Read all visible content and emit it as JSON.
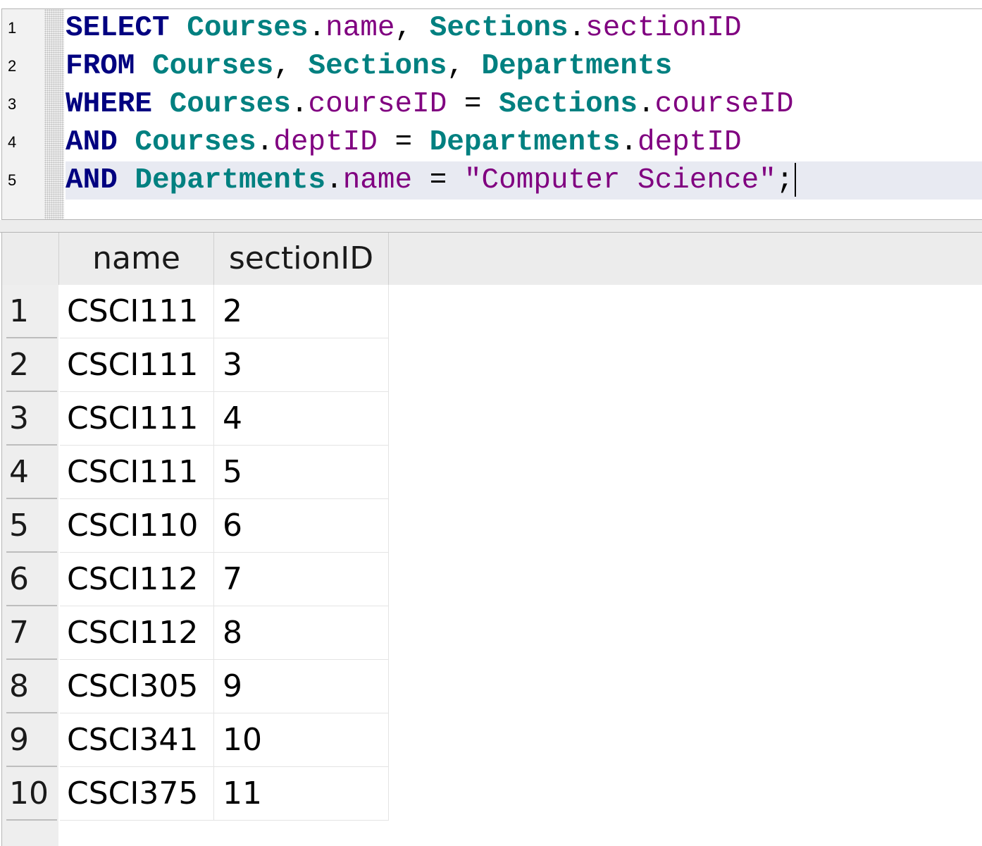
{
  "editor": {
    "line_numbers": [
      "1",
      "2",
      "3",
      "4",
      "5"
    ],
    "lines": [
      [
        {
          "t": "SELECT",
          "c": "kw"
        },
        {
          "t": " ",
          "c": "op"
        },
        {
          "t": "Courses",
          "c": "tbl"
        },
        {
          "t": ".",
          "c": "op"
        },
        {
          "t": "name",
          "c": "col"
        },
        {
          "t": ", ",
          "c": "op"
        },
        {
          "t": "Sections",
          "c": "tbl"
        },
        {
          "t": ".",
          "c": "op"
        },
        {
          "t": "sectionID",
          "c": "col"
        }
      ],
      [
        {
          "t": "FROM",
          "c": "kw"
        },
        {
          "t": " ",
          "c": "op"
        },
        {
          "t": "Courses",
          "c": "tbl"
        },
        {
          "t": ", ",
          "c": "op"
        },
        {
          "t": "Sections",
          "c": "tbl"
        },
        {
          "t": ", ",
          "c": "op"
        },
        {
          "t": "Departments",
          "c": "tbl"
        }
      ],
      [
        {
          "t": "WHERE",
          "c": "kw"
        },
        {
          "t": " ",
          "c": "op"
        },
        {
          "t": "Courses",
          "c": "tbl"
        },
        {
          "t": ".",
          "c": "op"
        },
        {
          "t": "courseID",
          "c": "col"
        },
        {
          "t": " = ",
          "c": "op"
        },
        {
          "t": "Sections",
          "c": "tbl"
        },
        {
          "t": ".",
          "c": "op"
        },
        {
          "t": "courseID",
          "c": "col"
        }
      ],
      [
        {
          "t": "AND",
          "c": "kw"
        },
        {
          "t": " ",
          "c": "op"
        },
        {
          "t": "Courses",
          "c": "tbl"
        },
        {
          "t": ".",
          "c": "op"
        },
        {
          "t": "deptID",
          "c": "col"
        },
        {
          "t": " = ",
          "c": "op"
        },
        {
          "t": "Departments",
          "c": "tbl"
        },
        {
          "t": ".",
          "c": "op"
        },
        {
          "t": "deptID",
          "c": "col"
        }
      ],
      [
        {
          "t": "AND",
          "c": "kw"
        },
        {
          "t": " ",
          "c": "op"
        },
        {
          "t": "Departments",
          "c": "tbl"
        },
        {
          "t": ".",
          "c": "op"
        },
        {
          "t": "name",
          "c": "col"
        },
        {
          "t": " = ",
          "c": "op"
        },
        {
          "t": "\"Computer Science\"",
          "c": "str"
        },
        {
          "t": ";",
          "c": "op"
        }
      ]
    ],
    "current_line": 5,
    "colors": {
      "keyword": "#000080",
      "table": "#008080",
      "column": "#800080",
      "string": "#800080",
      "current_line_bg": "#e8eaf2"
    }
  },
  "results": {
    "columns": [
      "name",
      "sectionID"
    ],
    "rows": [
      {
        "num": "1",
        "name": "CSCI111",
        "sectionID": "2"
      },
      {
        "num": "2",
        "name": "CSCI111",
        "sectionID": "3"
      },
      {
        "num": "3",
        "name": "CSCI111",
        "sectionID": "4"
      },
      {
        "num": "4",
        "name": "CSCI111",
        "sectionID": "5"
      },
      {
        "num": "5",
        "name": "CSCI110",
        "sectionID": "6"
      },
      {
        "num": "6",
        "name": "CSCI112",
        "sectionID": "7"
      },
      {
        "num": "7",
        "name": "CSCI112",
        "sectionID": "8"
      },
      {
        "num": "8",
        "name": "CSCI305",
        "sectionID": "9"
      },
      {
        "num": "9",
        "name": "CSCI341",
        "sectionID": "10"
      },
      {
        "num": "10",
        "name": "CSCI375",
        "sectionID": "11"
      }
    ]
  }
}
